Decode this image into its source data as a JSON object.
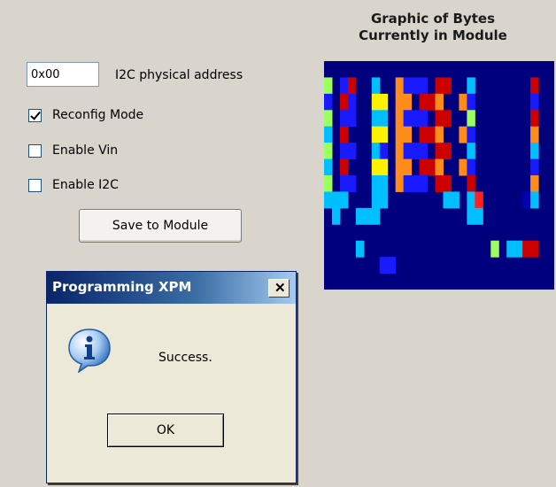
{
  "address": {
    "value": "0x00",
    "label": "I2C physical address"
  },
  "checkboxes": [
    {
      "label": "Reconfig Mode",
      "checked": true
    },
    {
      "label": "Enable Vin",
      "checked": false
    },
    {
      "label": "Enable I2C",
      "checked": false
    }
  ],
  "save_button": "Save to Module",
  "graphic": {
    "title_line1": "Graphic of Bytes",
    "title_line2": "Currently in Module",
    "background_color": "#00007f",
    "palette": {
      "a": "#9cff60",
      "b": "#1a1aff",
      "c": "#cc0000",
      "d": "#00bfff",
      "e": "#fff200",
      "f": "#ff8c1a",
      "g": "#0000b0",
      "h": "#ff2020"
    },
    "grid": [
      ".............................",
      "a.bc..d..fbbb.cc..d.......c..",
      "b.cb..ee.ff.ccf..fb.......b..",
      "a.bb..dd.fbbb.cc..a.......c..",
      "d.c...ee.ff.ccf..fb.......f..",
      "a.bb..db.fbbb.cc..d.......d..",
      "d.c...ee.ff.ccf..fb.......b..",
      "a.bb..dd.fbbb.cc..c.......f..",
      "ddd...dd.......dd.dh.....gd..",
      ".d..ddd...........dd.........",
      ".............................",
      "....d................a.ddcc..",
      ".......bb....................",
      "............................."
    ]
  },
  "dialog": {
    "title": "Programming XPM",
    "close_label": "✕",
    "message": "Success.",
    "ok_label": "OK",
    "icon": "info-icon"
  }
}
